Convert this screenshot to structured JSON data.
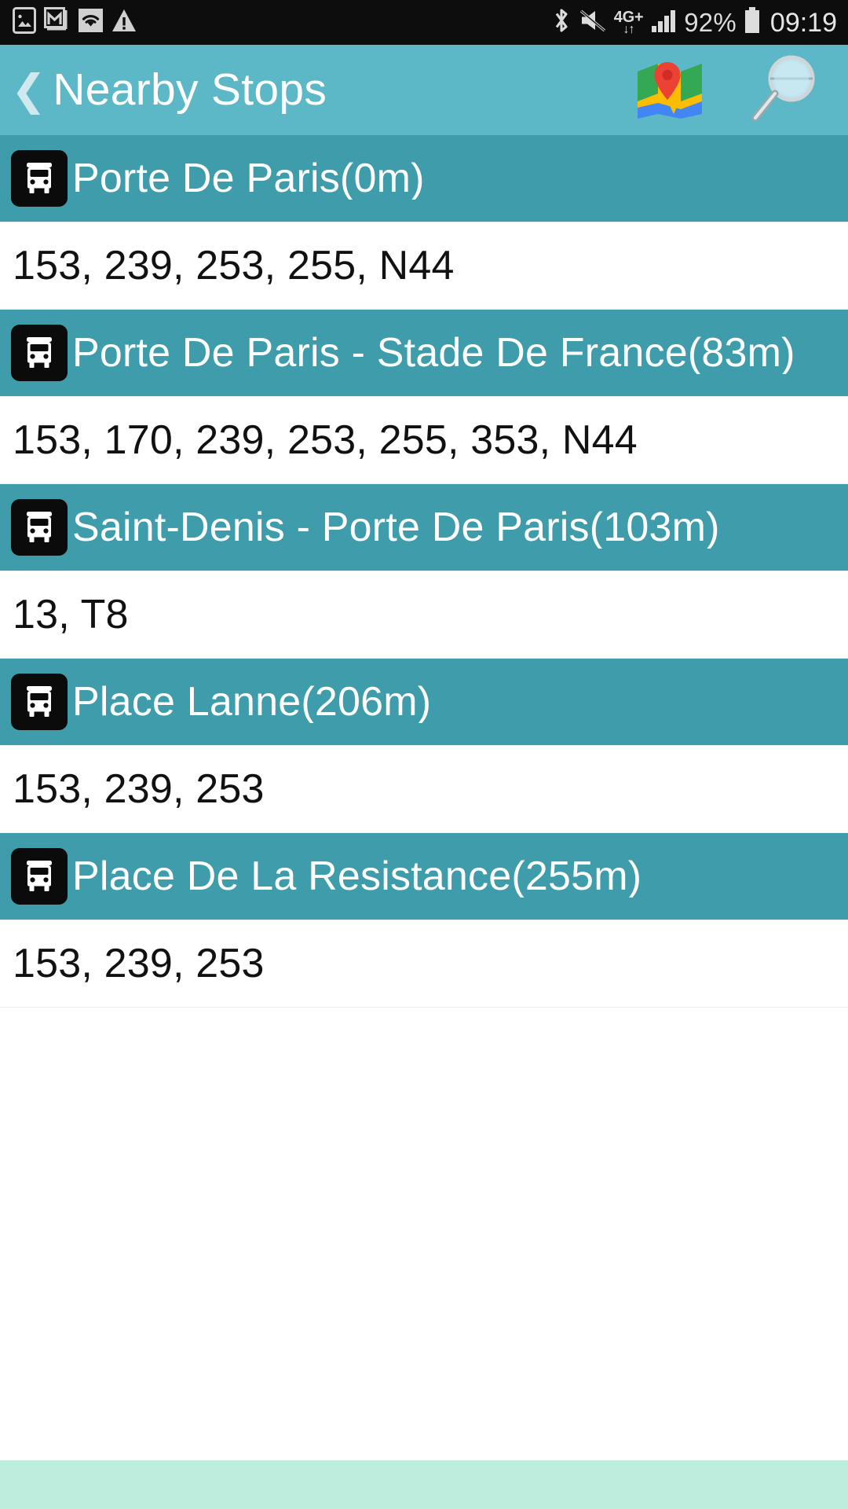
{
  "status_bar": {
    "left_icons": [
      "photo-icon",
      "gmail-icon",
      "wifi-icon",
      "warning-icon"
    ],
    "right_icons": [
      "bluetooth-icon",
      "mute-icon",
      "signal-icon",
      "battery-icon"
    ],
    "network_label": "4G+",
    "network_arrows": "↓↑",
    "battery_percent": "92%",
    "time": "09:19"
  },
  "header": {
    "back_chevron": "❮",
    "title": "Nearby Stops",
    "map_button_name": "map-icon",
    "search_button_name": "search-icon",
    "background_color": "#5cb8c6"
  },
  "colors": {
    "status_bar": "#0d0d0d",
    "header": "#5cb8c6",
    "stop_row": "#3e9cab",
    "routes_row": "#ffffff",
    "bottom_strip": "#bdeedd",
    "badge": "#0b0b0b"
  },
  "stops": [
    {
      "name": "Porte De Paris(0m)",
      "routes": "153, 239, 253, 255, N44",
      "icon": "bus-icon"
    },
    {
      "name": "Porte De Paris - Stade De France(83m)",
      "routes": "153, 170, 239, 253, 255, 353, N44",
      "icon": "bus-icon"
    },
    {
      "name": "Saint-Denis - Porte De Paris(103m)",
      "routes": "13, T8",
      "icon": "bus-icon"
    },
    {
      "name": "Place Lanne(206m)",
      "routes": "153, 239, 253",
      "icon": "bus-icon"
    },
    {
      "name": "Place De La Resistance(255m)",
      "routes": "153, 239, 253",
      "icon": "bus-icon"
    }
  ]
}
